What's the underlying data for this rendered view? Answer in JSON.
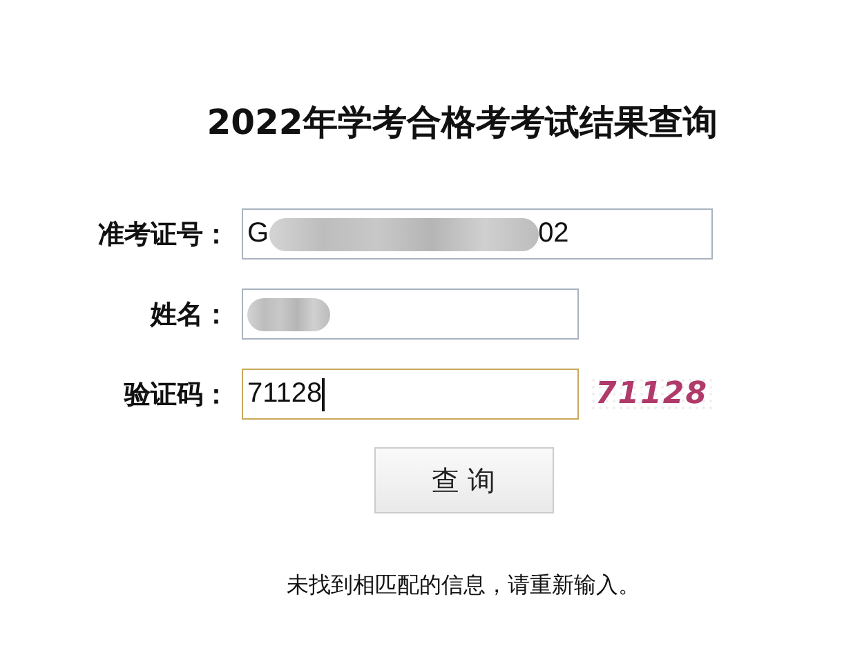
{
  "title": "2022年学考合格考考试结果查询",
  "fields": [
    {
      "kind": "wide",
      "label": "准考证号：",
      "value_start": "G",
      "redacted": true,
      "value_end": "02",
      "focused": false
    },
    {
      "kind": "narrow",
      "label": "姓名：",
      "redacted": true,
      "focused": false
    },
    {
      "kind": "narrow",
      "label": "验证码：",
      "value_start": "71128",
      "redacted": false,
      "focused": true,
      "captcha": "71128"
    }
  ],
  "button": "查 询",
  "message": "未找到相匹配的信息，请重新输入。"
}
